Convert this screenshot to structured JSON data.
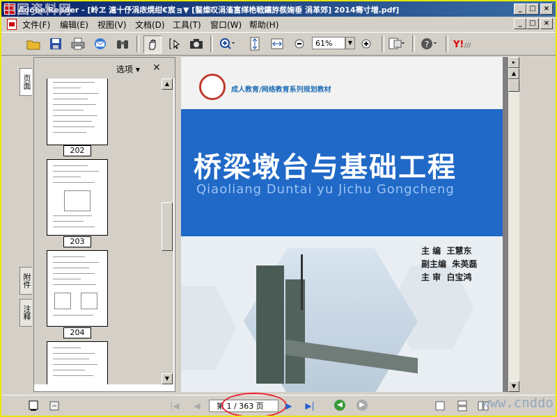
{
  "titlebar": {
    "title": "Adobe Reader - [岭ヱ  滬十伃涓庡熀绀€宸ョ▼ [鍪燦叹涓滀富缂栬戦鑲斿彂婅垂 涓革郊] 2014骞寸増.pdf]",
    "watermark": "中国资料网",
    "minimize": "_",
    "maximize": "□",
    "close": "×"
  },
  "menubar": {
    "items": [
      "文件(F)",
      "编辑(E)",
      "视图(V)",
      "文档(D)",
      "工具(T)",
      "窗口(W)",
      "帮助(H)"
    ]
  },
  "toolbar": {
    "zoom_value": "61%"
  },
  "navtabs": {
    "pages": "页面",
    "attachments": "附件",
    "comments": "注释"
  },
  "thumbpanel": {
    "options_label": "选项 ▾",
    "close_label": "×",
    "pages": [
      "202",
      "203",
      "204"
    ]
  },
  "cover": {
    "series": "成人教育/网络教育系列规划教材",
    "title": "桥梁墩台与基础工程",
    "pinyin": "Qiaoliang Duntai yu Jichu Gongcheng",
    "credits": [
      {
        "role": "主    编",
        "name": "王慧东"
      },
      {
        "role": "副主编",
        "name": "朱英磊"
      },
      {
        "role": "主    审",
        "name": "白宝鸿"
      }
    ]
  },
  "statusbar": {
    "page_indicator": "第 1 / 363 页",
    "watermark": "www.cnddo.com"
  },
  "colors": {
    "title_bar": "#0a246a",
    "cover_band": "#2069c7",
    "highlight_ellipse": "#e22233",
    "frame": "#e8e800"
  }
}
